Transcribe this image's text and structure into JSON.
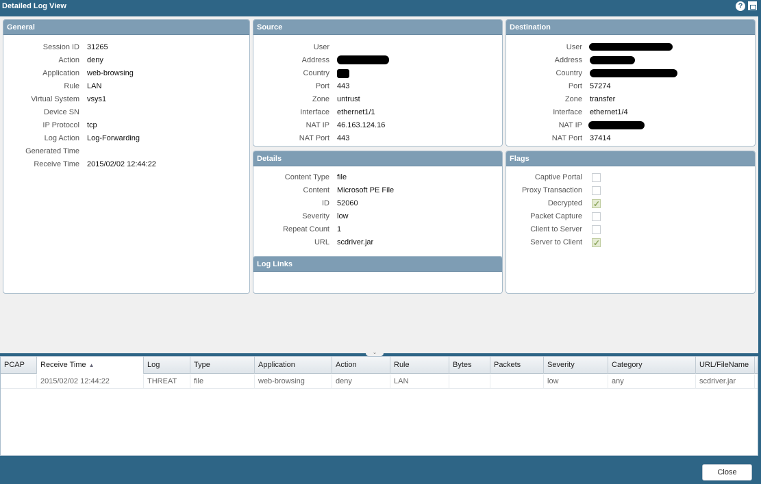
{
  "window": {
    "title": "Detailed Log View",
    "help_icon_glyph": "?"
  },
  "general": {
    "title": "General",
    "fields": [
      {
        "label": "Session ID",
        "value": "31265"
      },
      {
        "label": "Action",
        "value": "deny"
      },
      {
        "label": "Application",
        "value": "web-browsing"
      },
      {
        "label": "Rule",
        "value": "LAN"
      },
      {
        "label": "Virtual System",
        "value": "vsys1"
      },
      {
        "label": "Device SN",
        "value": ""
      },
      {
        "label": "IP Protocol",
        "value": "tcp"
      },
      {
        "label": "Log Action",
        "value": "Log-Forwarding"
      },
      {
        "label": "Generated Time",
        "value": ""
      },
      {
        "label": "Receive Time",
        "value": "2015/02/02 12:44:22"
      }
    ]
  },
  "source": {
    "title": "Source",
    "fields": [
      {
        "label": "User",
        "value": ""
      },
      {
        "label": "Address",
        "value": ""
      },
      {
        "label": "Country",
        "value": ""
      },
      {
        "label": "Port",
        "value": "443"
      },
      {
        "label": "Zone",
        "value": "untrust"
      },
      {
        "label": "Interface",
        "value": "ethernet1/1"
      },
      {
        "label": "NAT IP",
        "value": "46.163.124.16"
      },
      {
        "label": "NAT Port",
        "value": "443"
      }
    ]
  },
  "destination": {
    "title": "Destination",
    "fields": [
      {
        "label": "User",
        "value": ""
      },
      {
        "label": "Address",
        "value": ""
      },
      {
        "label": "Country",
        "value": ""
      },
      {
        "label": "Port",
        "value": "57274"
      },
      {
        "label": "Zone",
        "value": "transfer"
      },
      {
        "label": "Interface",
        "value": "ethernet1/4"
      },
      {
        "label": "NAT IP",
        "value": ""
      },
      {
        "label": "NAT Port",
        "value": "37414"
      }
    ]
  },
  "details": {
    "title": "Details",
    "fields": [
      {
        "label": "Content Type",
        "value": "file"
      },
      {
        "label": "Content",
        "value": "Microsoft PE File"
      },
      {
        "label": "ID",
        "value": "52060"
      },
      {
        "label": "Severity",
        "value": "low"
      },
      {
        "label": "Repeat Count",
        "value": "1"
      },
      {
        "label": "URL",
        "value": "scdriver.jar"
      }
    ]
  },
  "flags": {
    "title": "Flags",
    "items": [
      {
        "label": "Captive Portal",
        "checked": false
      },
      {
        "label": "Proxy Transaction",
        "checked": false
      },
      {
        "label": "Decrypted",
        "checked": true
      },
      {
        "label": "Packet Capture",
        "checked": false
      },
      {
        "label": "Client to Server",
        "checked": false
      },
      {
        "label": "Server to Client",
        "checked": true
      }
    ]
  },
  "log_links": {
    "title": "Log Links"
  },
  "table": {
    "columns": [
      "PCAP",
      "Receive Time",
      "Log",
      "Type",
      "Application",
      "Action",
      "Rule",
      "Bytes",
      "Packets",
      "Severity",
      "Category",
      "URL/FileName"
    ],
    "sorted_column": "Receive Time",
    "rows": [
      [
        "",
        "2015/02/02 12:44:22",
        "THREAT",
        "file",
        "web-browsing",
        "deny",
        "LAN",
        "",
        "",
        "low",
        "any",
        "scdriver.jar"
      ]
    ]
  },
  "footer": {
    "close_label": "Close"
  },
  "colors": {
    "title_bar": "#2e6586",
    "panel_header": "#7e9db4",
    "check_on": "#8fa860"
  }
}
